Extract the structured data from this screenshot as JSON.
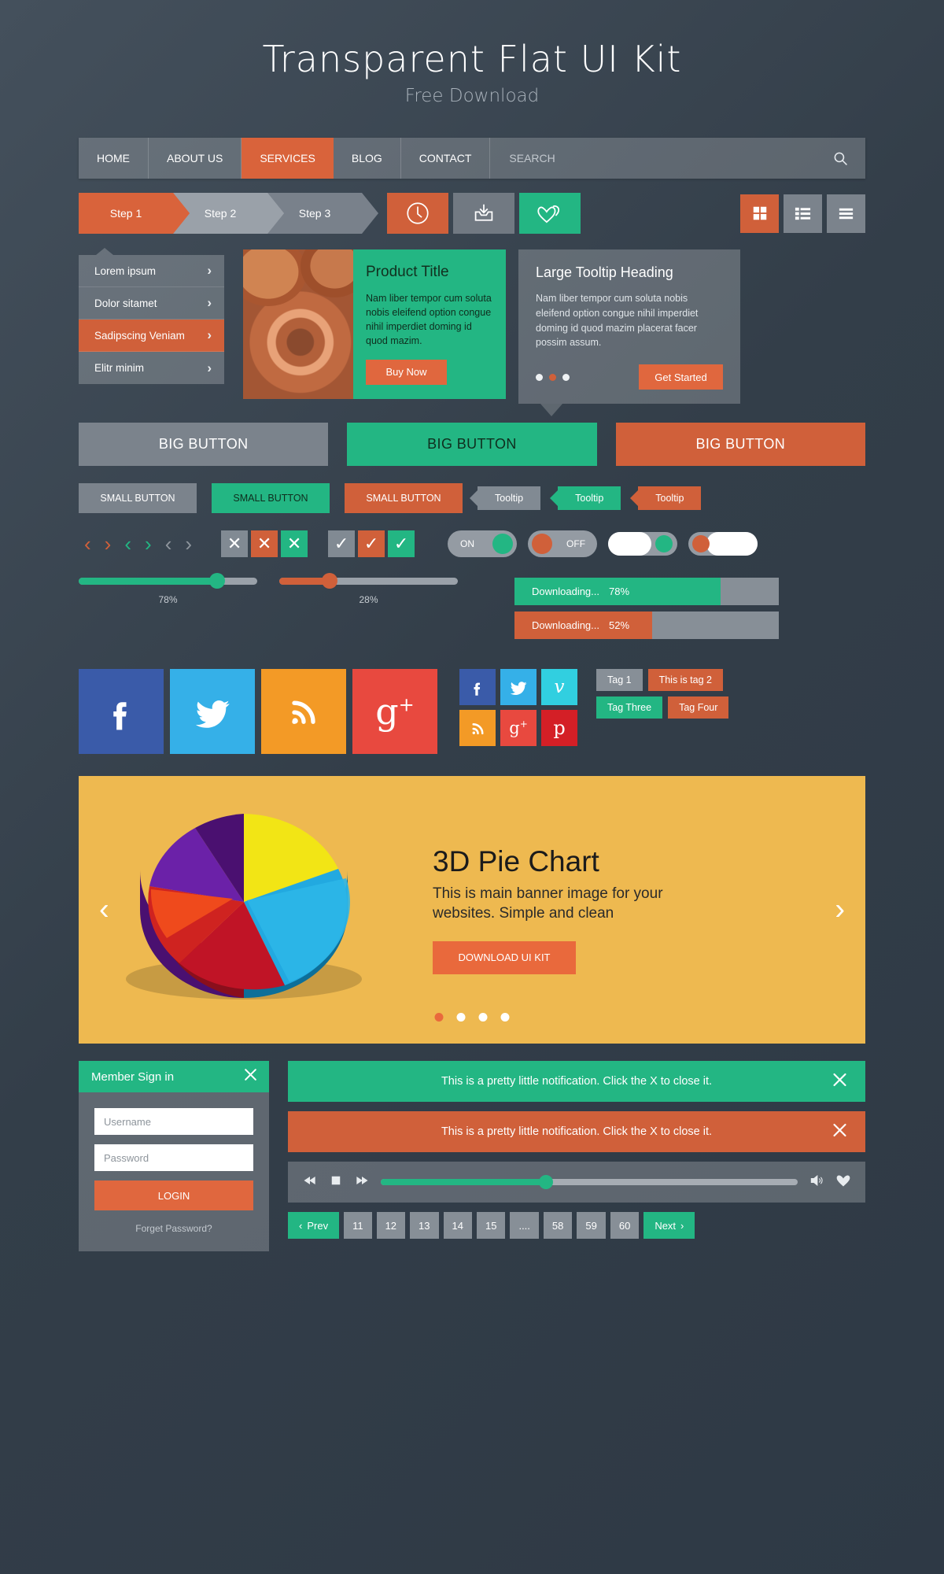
{
  "header": {
    "title": "Transparent Flat UI Kit",
    "subtitle": "Free Download"
  },
  "nav": {
    "items": [
      {
        "label": "HOME",
        "active": false
      },
      {
        "label": "ABOUT US",
        "active": false
      },
      {
        "label": "SERVICES",
        "active": true
      },
      {
        "label": "BLOG",
        "active": false
      },
      {
        "label": "CONTACT",
        "active": false
      }
    ],
    "search_placeholder": "SEARCH"
  },
  "steps": [
    {
      "label": "Step 1",
      "active": true
    },
    {
      "label": "Step 2",
      "active": false
    },
    {
      "label": "Step 3",
      "active": false
    }
  ],
  "icon_buttons": [
    {
      "name": "clock-icon",
      "color": "#d0603a"
    },
    {
      "name": "inbox-download-icon",
      "color": "#717982"
    },
    {
      "name": "hearts-icon",
      "color": "#23b683"
    }
  ],
  "view_buttons": [
    {
      "name": "grid-view-icon",
      "color": "#d0603a"
    },
    {
      "name": "list-view-icon",
      "color": "#7b838c"
    },
    {
      "name": "menu-lines-icon",
      "color": "#7b838c"
    }
  ],
  "menu_card": {
    "items": [
      {
        "label": "Lorem ipsum",
        "active": false
      },
      {
        "label": "Dolor sitamet",
        "active": false
      },
      {
        "label": "Sadipscing Veniam",
        "active": true
      },
      {
        "label": "Elitr minim",
        "active": false
      }
    ]
  },
  "product_card": {
    "title": "Product Title",
    "body": "Nam liber tempor cum soluta nobis eleifend option congue nihil imperdiet doming id quod mazim.",
    "button": "Buy Now"
  },
  "tooltip_card": {
    "title": "Large Tooltip Heading",
    "body": "Nam liber tempor cum soluta nobis eleifend option congue nihil imperdiet doming id quod mazim placerat facer possim assum.",
    "button": "Get Started",
    "dots": 3,
    "active_dot": 1
  },
  "big_buttons": [
    {
      "label": "BIG BUTTON",
      "style": "grey"
    },
    {
      "label": "BIG BUTTON",
      "style": "green"
    },
    {
      "label": "BIG BUTTON",
      "style": "orange"
    }
  ],
  "small_buttons": [
    {
      "label": "SMALL BUTTON",
      "style": "grey"
    },
    {
      "label": "SMALL BUTTON",
      "style": "green"
    },
    {
      "label": "SMALL BUTTON",
      "style": "orange"
    }
  ],
  "tooltips": [
    {
      "label": "Tooltip",
      "style": "grey"
    },
    {
      "label": "Tooltip",
      "style": "green"
    },
    {
      "label": "Tooltip",
      "style": "orange"
    }
  ],
  "toggles": [
    {
      "label": "ON",
      "state": "on"
    },
    {
      "label": "OFF",
      "state": "off"
    }
  ],
  "sliders": [
    {
      "value": "78%",
      "style": "green"
    },
    {
      "value": "28%",
      "style": "orange"
    }
  ],
  "progress": [
    {
      "label": "Downloading...",
      "value": "78%",
      "style": "green"
    },
    {
      "label": "Downloading...",
      "value": "52%",
      "style": "orange"
    }
  ],
  "social_big": [
    {
      "name": "facebook-icon",
      "glyph": "f",
      "color": "#3a5ba9"
    },
    {
      "name": "twitter-icon",
      "glyph": "t",
      "color": "#35b0e8"
    },
    {
      "name": "rss-icon",
      "glyph": "r",
      "color": "#f39a26"
    },
    {
      "name": "googleplus-icon",
      "glyph": "g+",
      "color": "#e8493f"
    }
  ],
  "social_small": [
    {
      "name": "facebook-icon",
      "glyph": "f",
      "color": "#3a5ba9"
    },
    {
      "name": "twitter-icon",
      "glyph": "t",
      "color": "#35b0e8"
    },
    {
      "name": "vimeo-icon",
      "glyph": "v",
      "color": "#31cfe0"
    },
    {
      "name": "rss-icon",
      "glyph": "r",
      "color": "#f39a26"
    },
    {
      "name": "googleplus-icon",
      "glyph": "g+",
      "color": "#e8493f"
    },
    {
      "name": "pinterest-icon",
      "glyph": "p",
      "color": "#d41f26"
    }
  ],
  "tags": [
    {
      "label": "Tag 1",
      "style": "grey"
    },
    {
      "label": "This is tag 2",
      "style": "orange"
    },
    {
      "label": "Tag Three",
      "style": "green"
    },
    {
      "label": "Tag Four",
      "style": "orange"
    }
  ],
  "banner": {
    "title": "3D Pie Chart",
    "body": "This is main banner image for your websites. Simple and clean",
    "button": "DOWNLOAD UI KIT",
    "dots": 4,
    "active_dot": 0
  },
  "login": {
    "title": "Member Sign in",
    "username_placeholder": "Username",
    "password_placeholder": "Password",
    "submit": "LOGIN",
    "forget": "Forget Password?"
  },
  "notifications": [
    {
      "text": "This is a pretty little notification. Click the X to close it.",
      "style": "green"
    },
    {
      "text": "This is a pretty little notification. Click the X to close it.",
      "style": "orange"
    }
  ],
  "pagination": [
    {
      "label": "Prev",
      "style": "green",
      "icon": "chevron-left"
    },
    {
      "label": "11",
      "style": "grey"
    },
    {
      "label": "12",
      "style": "grey"
    },
    {
      "label": "13",
      "style": "grey"
    },
    {
      "label": "14",
      "style": "grey"
    },
    {
      "label": "15",
      "style": "grey"
    },
    {
      "label": "....",
      "style": "grey"
    },
    {
      "label": "58",
      "style": "grey"
    },
    {
      "label": "59",
      "style": "grey"
    },
    {
      "label": "60",
      "style": "grey"
    },
    {
      "label": "Next",
      "style": "green",
      "icon": "chevron-right"
    }
  ],
  "chart_data": {
    "type": "pie",
    "title": "3D Pie Chart",
    "categories": [
      "Yellow",
      "Cyan",
      "Red",
      "Crimson",
      "Purple",
      "Orange"
    ],
    "values": [
      18,
      26,
      14,
      16,
      16,
      10
    ],
    "colors": [
      "#f2e515",
      "#22a9e0",
      "#e13b22",
      "#c01426",
      "#6b21a8",
      "#f05a22"
    ],
    "legend": "none"
  },
  "colors": {
    "accent_orange": "#d0603a",
    "accent_green": "#23b683",
    "grey": "#7b838c",
    "bg": "#3b4752",
    "banner_bg": "#eeb950"
  }
}
